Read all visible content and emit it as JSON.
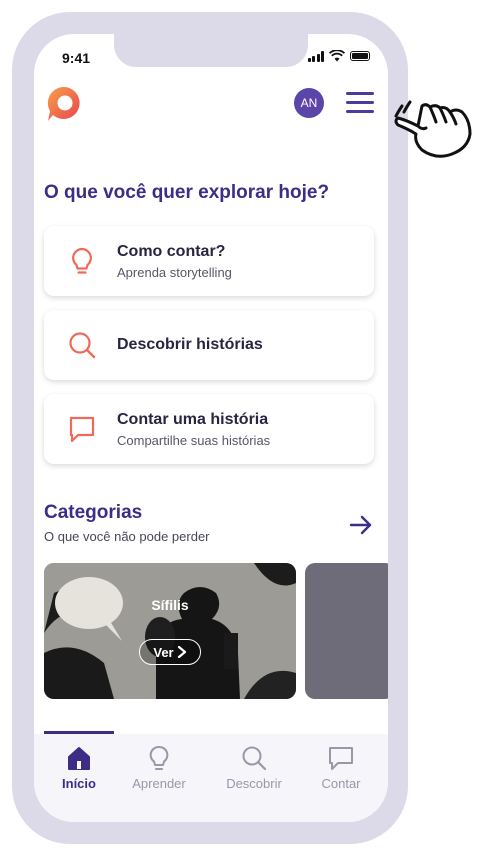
{
  "status_bar": {
    "time": "9:41"
  },
  "header": {
    "avatar_initials": "AN",
    "menu_icon": "hamburger-menu-icon",
    "logo_icon": "speech-bubble-logo"
  },
  "explore": {
    "title": "O que você quer explorar hoje?",
    "options": [
      {
        "icon": "lightbulb-icon",
        "title": "Como contar?",
        "subtitle": "Aprenda storytelling"
      },
      {
        "icon": "search-icon",
        "title": "Descobrir histórias"
      },
      {
        "icon": "chat-bubble-icon",
        "title": "Contar uma história",
        "subtitle": "Compartilhe suas histórias"
      }
    ]
  },
  "categories": {
    "title": "Categorias",
    "subtitle": "O que você não pode perder",
    "items": [
      {
        "label": "Sífilis",
        "button": "Ver"
      }
    ]
  },
  "bottom_nav": {
    "items": [
      {
        "label": "Início",
        "icon": "home-icon",
        "active": true
      },
      {
        "label": "Aprender",
        "icon": "lightbulb-icon"
      },
      {
        "label": "Descobrir",
        "icon": "search-icon"
      },
      {
        "label": "Contar",
        "icon": "chat-bubble-icon"
      }
    ]
  },
  "colors": {
    "brand": "#3d2d86",
    "accent": "#ef6a5a",
    "frame": "#dcd9e9"
  }
}
